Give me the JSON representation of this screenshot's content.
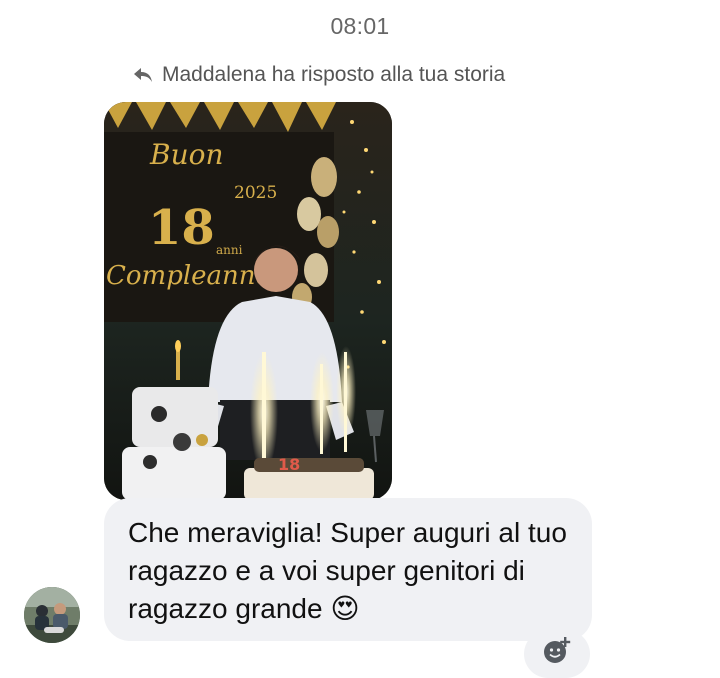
{
  "thread": {
    "timestamp": "08:01",
    "reply_note": "Maddalena ha risposto alla tua storia"
  },
  "story": {
    "banner_text_1": "Buon",
    "banner_year": "2025",
    "banner_age": "18",
    "banner_text_2": "anni",
    "banner_text_3": "Compleanno",
    "candle_number": "18"
  },
  "message": {
    "sender": "Maddalena",
    "text": "Che meraviglia! Super auguri al tuo ragazzo e a voi super genitori di ragazzo grande 😍"
  },
  "icons": {
    "reply": "reply-arrow-icon",
    "react": "add-reaction-icon"
  },
  "colors": {
    "bubble_bg": "#f0f1f4",
    "timestamp": "#666666",
    "gold": "#d8b04c"
  }
}
